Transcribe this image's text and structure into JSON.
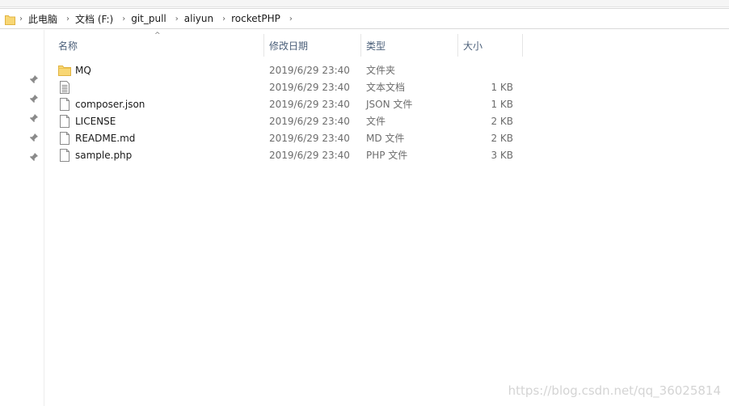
{
  "breadcrumb": [
    "此电脑",
    "文档 (F:)",
    "git_pull",
    "aliyun",
    "rocketPHP"
  ],
  "columns": {
    "name": "名称",
    "date": "修改日期",
    "type": "类型",
    "size": "大小"
  },
  "files": [
    {
      "name": "MQ",
      "date": "2019/6/29 23:40",
      "type": "文件夹",
      "size": "",
      "icon": "folder-icon"
    },
    {
      "name": "",
      "date": "2019/6/29 23:40",
      "type": "文本文档",
      "size": "1 KB",
      "icon": "text-document-icon"
    },
    {
      "name": "composer.json",
      "date": "2019/6/29 23:40",
      "type": "JSON 文件",
      "size": "1 KB",
      "icon": "file-icon"
    },
    {
      "name": "LICENSE",
      "date": "2019/6/29 23:40",
      "type": "文件",
      "size": "2 KB",
      "icon": "file-icon"
    },
    {
      "name": "README.md",
      "date": "2019/6/29 23:40",
      "type": "MD 文件",
      "size": "2 KB",
      "icon": "file-icon"
    },
    {
      "name": "sample.php",
      "date": "2019/6/29 23:40",
      "type": "PHP 文件",
      "size": "3 KB",
      "icon": "file-icon"
    }
  ],
  "watermark": "https://blog.csdn.net/qq_36025814",
  "colors": {
    "folder": "#f8d775",
    "folder_edge": "#e0b341",
    "header_text": "#4c607a"
  }
}
